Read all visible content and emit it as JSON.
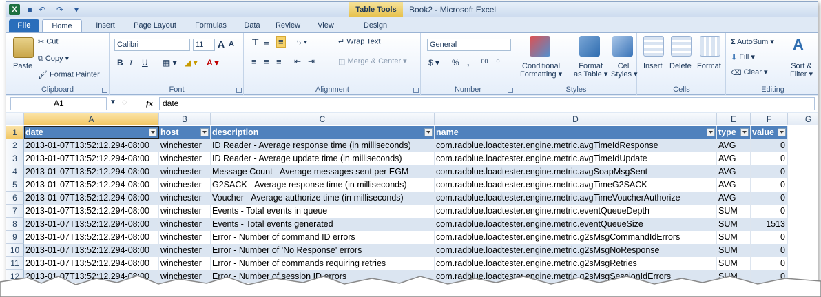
{
  "window": {
    "title": "Book2 - Microsoft Excel",
    "context_tab": "Table Tools",
    "app_icon_letter": "X"
  },
  "tabs": [
    "File",
    "Home",
    "Insert",
    "Page Layout",
    "Formulas",
    "Data",
    "Review",
    "View",
    "Design"
  ],
  "ribbon": {
    "clipboard": {
      "paste": "Paste",
      "cut": "Cut",
      "copy": "Copy",
      "format_painter": "Format Painter",
      "label": "Clipboard"
    },
    "font": {
      "name": "Calibri",
      "size": "11",
      "bold": "B",
      "italic": "I",
      "underline": "U",
      "grow": "A",
      "shrink": "A",
      "label": "Font"
    },
    "alignment": {
      "wrap": "Wrap Text",
      "merge": "Merge & Center",
      "label": "Alignment"
    },
    "number": {
      "format": "General",
      "currency": "$",
      "percent": "%",
      "comma": ",",
      "inc_decimal": ".00",
      "dec_decimal": ".0",
      "label": "Number"
    },
    "styles": {
      "conditional_1": "Conditional",
      "conditional_2": "Formatting",
      "format_table_1": "Format",
      "format_table_2": "as Table",
      "cell_styles_1": "Cell",
      "cell_styles_2": "Styles",
      "label": "Styles"
    },
    "cells": {
      "insert": "Insert",
      "delete": "Delete",
      "format": "Format",
      "label": "Cells"
    },
    "editing": {
      "autosum": "AutoSum",
      "fill": "Fill",
      "clear": "Clear",
      "sort_1": "Sort &",
      "sort_2": "Filter",
      "label": "Editing"
    }
  },
  "formula_bar": {
    "name_box": "A1",
    "fx": "fx",
    "value": "date"
  },
  "columns": [
    "A",
    "B",
    "C",
    "D",
    "E",
    "F",
    "G"
  ],
  "table": {
    "headers": [
      "date",
      "host",
      "description",
      "name",
      "type",
      "value"
    ],
    "rows": [
      [
        "2013-01-07T13:52:12.294-08:00",
        "winchester",
        "ID Reader - Average response time (in milliseconds)",
        "com.radblue.loadtester.engine.metric.avgTimeIdResponse",
        "AVG",
        "0"
      ],
      [
        "2013-01-07T13:52:12.294-08:00",
        "winchester",
        "ID Reader - Average update time (in milliseconds)",
        "com.radblue.loadtester.engine.metric.avgTimeIdUpdate",
        "AVG",
        "0"
      ],
      [
        "2013-01-07T13:52:12.294-08:00",
        "winchester",
        "Message Count - Average messages sent per EGM",
        "com.radblue.loadtester.engine.metric.avgSoapMsgSent",
        "AVG",
        "0"
      ],
      [
        "2013-01-07T13:52:12.294-08:00",
        "winchester",
        "G2SACK - Average response time (in milliseconds)",
        "com.radblue.loadtester.engine.metric.avgTimeG2SACK",
        "AVG",
        "0"
      ],
      [
        "2013-01-07T13:52:12.294-08:00",
        "winchester",
        "Voucher - Average authorize time (in milliseconds)",
        "com.radblue.loadtester.engine.metric.avgTimeVoucherAuthorize",
        "AVG",
        "0"
      ],
      [
        "2013-01-07T13:52:12.294-08:00",
        "winchester",
        "Events - Total events in queue",
        "com.radblue.loadtester.engine.metric.eventQueueDepth",
        "SUM",
        "0"
      ],
      [
        "2013-01-07T13:52:12.294-08:00",
        "winchester",
        "Events - Total events generated",
        "com.radblue.loadtester.engine.metric.eventQueueSize",
        "SUM",
        "1513"
      ],
      [
        "2013-01-07T13:52:12.294-08:00",
        "winchester",
        "Error - Number of command ID errors",
        "com.radblue.loadtester.engine.metric.g2sMsgCommandIdErrors",
        "SUM",
        "0"
      ],
      [
        "2013-01-07T13:52:12.294-08:00",
        "winchester",
        "Error - Number of 'No Response' errors",
        "com.radblue.loadtester.engine.metric.g2sMsgNoResponse",
        "SUM",
        "0"
      ],
      [
        "2013-01-07T13:52:12.294-08:00",
        "winchester",
        "Error - Number of commands requiring retries",
        "com.radblue.loadtester.engine.metric.g2sMsgRetries",
        "SUM",
        "0"
      ],
      [
        "2013-01-07T13:52:12.294-08:00",
        "winchester",
        "Error - Number of session ID errors",
        "com.radblue.loadtester.engine.metric.g2sMsgSessionIdErrors",
        "SUM",
        "0"
      ]
    ]
  },
  "colors": {
    "header_fill": "#4f81bd",
    "band_fill": "#dbe5f1",
    "accent": "#2a6ebb"
  }
}
